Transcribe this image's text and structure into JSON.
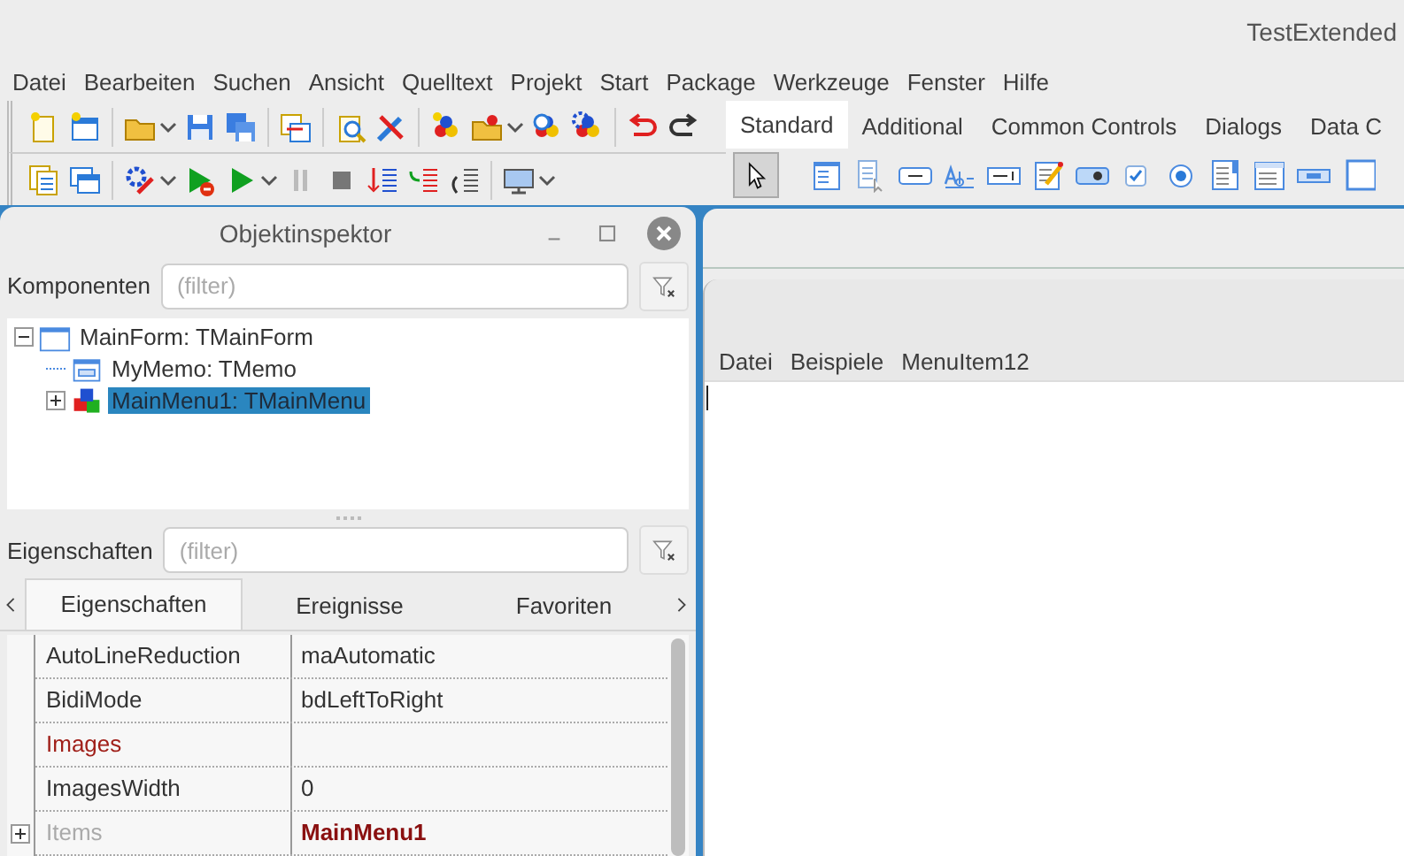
{
  "window": {
    "title": "TestExtended"
  },
  "menu": [
    "Datei",
    "Bearbeiten",
    "Suchen",
    "Ansicht",
    "Quelltext",
    "Projekt",
    "Start",
    "Package",
    "Werkzeuge",
    "Fenster",
    "Hilfe"
  ],
  "palette_tabs": [
    {
      "label": "Standard",
      "selected": true
    },
    {
      "label": "Additional",
      "selected": false
    },
    {
      "label": "Common Controls",
      "selected": false
    },
    {
      "label": "Dialogs",
      "selected": false
    },
    {
      "label": "Data C",
      "selected": false
    }
  ],
  "inspector": {
    "title": "Objektinspektor",
    "components_label": "Komponenten",
    "components_filter": {
      "placeholder": "(filter)"
    },
    "tree": [
      {
        "label": "MainForm: TMainForm",
        "expanded": true,
        "selected": false,
        "children": [
          {
            "label": "MyMemo: TMemo",
            "selected": false
          },
          {
            "label": "MainMenu1: TMainMenu",
            "expanded": false,
            "selected": true
          }
        ]
      }
    ],
    "properties_label": "Eigenschaften",
    "properties_filter": {
      "placeholder": "(filter)"
    },
    "tabs": [
      {
        "label": "Eigenschaften",
        "selected": true
      },
      {
        "label": "Ereignisse",
        "selected": false
      },
      {
        "label": "Favoriten",
        "selected": false
      }
    ],
    "rows": [
      {
        "name": "AutoLineReduction",
        "value": "maAutomatic",
        "kind": "plain"
      },
      {
        "name": "BidiMode",
        "value": "bdLeftToRight",
        "kind": "plain"
      },
      {
        "name": "Images",
        "kind": "reference"
      },
      {
        "name": "ImagesWidth",
        "value": "0",
        "kind": "plain"
      },
      {
        "name": "Items",
        "value": "MainMenu1",
        "kind": "collection"
      }
    ]
  },
  "form": {
    "menu": [
      "Datei",
      "Beispiele",
      "MenuItem12"
    ]
  }
}
